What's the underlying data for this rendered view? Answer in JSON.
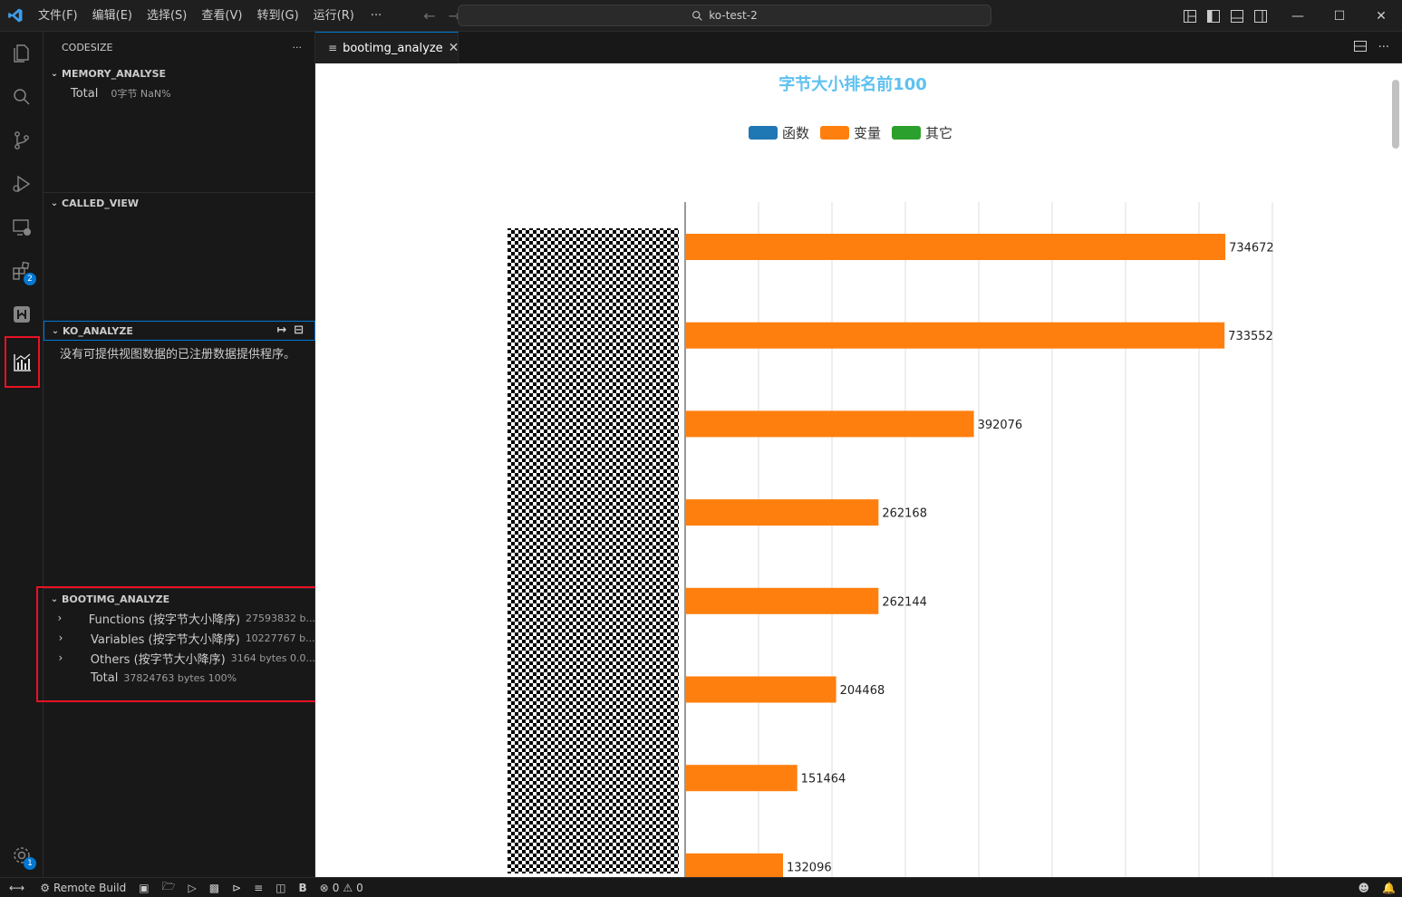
{
  "menu": {
    "items": [
      "文件(F)",
      "编辑(E)",
      "选择(S)",
      "查看(V)",
      "转到(G)",
      "运行(R)"
    ],
    "more": "···"
  },
  "command_center": {
    "label": "ko-test-2"
  },
  "activity_bar": {
    "extensions_badge": "2",
    "accounts_badge": "1"
  },
  "sidebar": {
    "title": "CODESIZE",
    "title_more": "···",
    "memory": {
      "header": "MEMORY_ANALYSE",
      "total_label": "Total",
      "total_desc": "0字节  NaN%"
    },
    "called": {
      "header": "CALLED_VIEW"
    },
    "ko": {
      "header": "KO_ANALYZE",
      "empty_message": "没有可提供视图数据的已注册数据提供程序。"
    },
    "bootimg": {
      "header": "BOOTIMG_ANALYZE",
      "items": [
        {
          "label": "Functions (按字节大小降序)",
          "desc": "27593832 b..."
        },
        {
          "label": "Variables (按字节大小降序)",
          "desc": "10227767 b..."
        },
        {
          "label": "Others (按字节大小降序)",
          "desc": "3164 bytes 0.0..."
        }
      ],
      "total_label": "Total",
      "total_desc": "37824763 bytes 100%"
    }
  },
  "editor": {
    "tab_label": "bootimg_analyze"
  },
  "chart_data": {
    "type": "bar",
    "orientation": "horizontal",
    "title": "字节大小排名前100",
    "legend": [
      {
        "name": "函数",
        "color": "#1f77b4"
      },
      {
        "name": "变量",
        "color": "#ff7f0e"
      },
      {
        "name": "其它",
        "color": "#2ca02c"
      }
    ],
    "legend_position": "top-center",
    "series": [
      {
        "name": "变量",
        "values": [
          734672,
          733552,
          392076,
          262168,
          262144,
          204468,
          151464,
          132096
        ]
      }
    ],
    "xlim": [
      0,
      800000
    ],
    "grid": true,
    "category_labels_obscured": true,
    "title_color": "#5ec1f0",
    "bar_color": "#ff7f0e"
  },
  "statusbar": {
    "remote": "Remote Build",
    "bold_b": "B",
    "errors": "0",
    "warnings": "0"
  }
}
